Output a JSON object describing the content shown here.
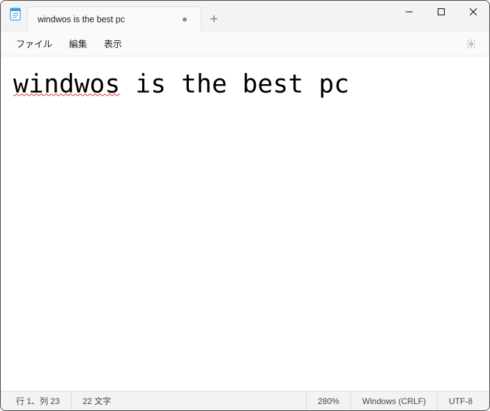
{
  "window": {
    "tab_title": "windwos is the best pc",
    "is_dirty": true
  },
  "menu": {
    "file": "ファイル",
    "edit": "編集",
    "view": "表示"
  },
  "editor": {
    "misspelled": "windwos",
    "rest": " is the best pc",
    "full_text": "windwos is the best pc",
    "zoom_percent": 280
  },
  "status": {
    "cursor": "行 1、列 23",
    "char_count": "22 文字",
    "zoom": "280%",
    "line_ending": "Windows (CRLF)",
    "encoding": "UTF-8"
  }
}
